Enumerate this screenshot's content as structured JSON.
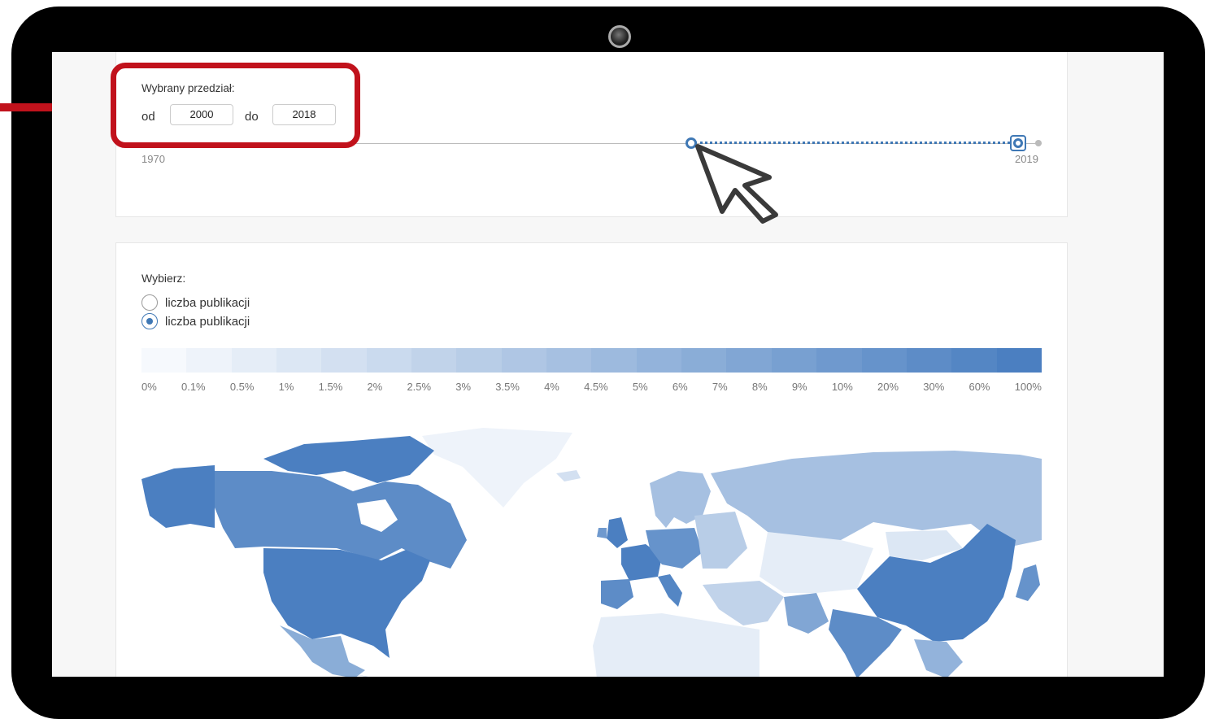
{
  "range": {
    "title": "Wybrany przedział:",
    "from_label": "od",
    "from_value": "2000",
    "to_label": "do",
    "to_value": "2018",
    "min_label": "1970",
    "max_label": "2019",
    "selected_start_fraction": 0.612,
    "selected_end_fraction": 0.98
  },
  "choice": {
    "title": "Wybierz:",
    "options": [
      "liczba publikacji",
      "liczba publikacji"
    ],
    "selected_index": 1
  },
  "legend": {
    "colors": [
      "#f6f9fd",
      "#eef3fa",
      "#e5edf7",
      "#dce7f4",
      "#d3e0f1",
      "#cadaee",
      "#c1d3ea",
      "#b8cde7",
      "#afc6e4",
      "#a6c0e1",
      "#9dbade",
      "#93b3db",
      "#8aadd7",
      "#81a6d4",
      "#78a0d1",
      "#6f99ce",
      "#6693cb",
      "#5d8cc7",
      "#5486c4",
      "#4b7fc1"
    ],
    "labels": [
      "0%",
      "0.1%",
      "0.5%",
      "1%",
      "1.5%",
      "2%",
      "2.5%",
      "3%",
      "3.5%",
      "4%",
      "4.5%",
      "5%",
      "6%",
      "7%",
      "8%",
      "9%",
      "10%",
      "20%",
      "30%",
      "60%",
      "100%"
    ]
  },
  "annotation": {
    "highlight_color": "#c1121c"
  }
}
